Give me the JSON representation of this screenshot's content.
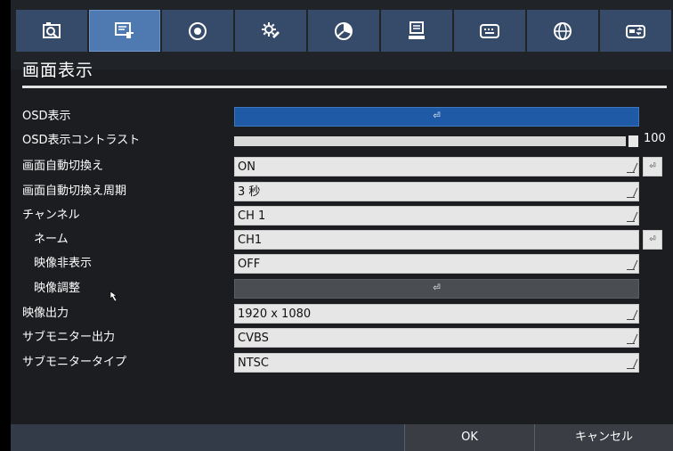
{
  "tabs": [
    {
      "icon": "camera-search-icon",
      "active": false
    },
    {
      "icon": "display-settings-icon",
      "active": true
    },
    {
      "icon": "record-icon",
      "active": false
    },
    {
      "icon": "gear-icon",
      "active": false
    },
    {
      "icon": "schedule-chart-icon",
      "active": false
    },
    {
      "icon": "network-computer-icon",
      "active": false
    },
    {
      "icon": "keyboard-icon",
      "active": false
    },
    {
      "icon": "globe-icon",
      "active": false
    },
    {
      "icon": "storage-device-icon",
      "active": false
    }
  ],
  "page_title": "画面表示",
  "rows": {
    "osd": {
      "label": "OSD表示"
    },
    "osd_contrast": {
      "label": "OSD表示コントラスト",
      "value": "100",
      "level": 1.0
    },
    "auto_switch": {
      "label": "画面自動切換え",
      "value": "ON"
    },
    "auto_switch_period": {
      "label": "画面自動切換え周期",
      "value": "3 秒"
    },
    "channel": {
      "label": "チャンネル",
      "value": "CH 1"
    },
    "name": {
      "label": "ネーム",
      "value": "CH1"
    },
    "video_hide": {
      "label": "映像非表示",
      "value": "OFF"
    },
    "video_adjust": {
      "label": "映像調整"
    },
    "video_output": {
      "label": "映像出力",
      "value": "1920 x 1080"
    },
    "sub_monitor_output": {
      "label": "サブモニター出力",
      "value": "CVBS"
    },
    "sub_monitor_type": {
      "label": "サブモニタータイプ",
      "value": "NTSC"
    }
  },
  "buttons": {
    "ok": "OK",
    "cancel": "キャンセル"
  },
  "colors": {
    "tab_bg": "#364a69",
    "tab_active": "#4f7ab1",
    "accent_blue": "#1f5aa6",
    "field_bg": "#e6e6e6"
  }
}
